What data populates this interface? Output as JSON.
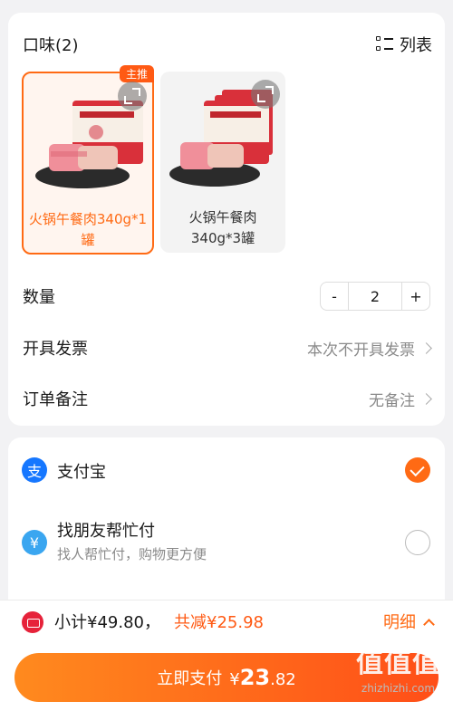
{
  "flavor": {
    "title": "口味(2)",
    "list_label": "列表",
    "options": [
      {
        "badge": "主推",
        "label": "火锅午餐肉340g*1罐",
        "selected": true,
        "image_icon": "luncheon-meat-can-image"
      },
      {
        "label": "火锅午餐肉340g*3罐",
        "selected": false,
        "image_icon": "luncheon-meat-3-cans-image"
      }
    ]
  },
  "quantity": {
    "label": "数量",
    "minus": "-",
    "value": "2",
    "plus": "+"
  },
  "invoice": {
    "label": "开具发票",
    "value": "本次不开具发票"
  },
  "note": {
    "label": "订单备注",
    "value": "无备注"
  },
  "payment": {
    "methods": [
      {
        "icon": "alipay-icon",
        "name": "支付宝",
        "selected": true
      },
      {
        "icon": "friend-pay-icon",
        "name": "找朋友帮忙付",
        "subtitle": "找人帮忙付，购物更方便",
        "selected": false
      }
    ]
  },
  "summary": {
    "subtotal": "小计¥49.80，",
    "discount": "共减¥25.98",
    "detail": "明细",
    "pay_label": "立即支付",
    "pay_currency": "¥",
    "pay_int": "23",
    "pay_dec": ".82"
  },
  "watermark": {
    "big": "值值值",
    "small": "zhizhizhi.com"
  },
  "colors": {
    "accent": "#ff6a14",
    "alipay": "#1677ff",
    "subtotal_icon": "#e6223a"
  }
}
